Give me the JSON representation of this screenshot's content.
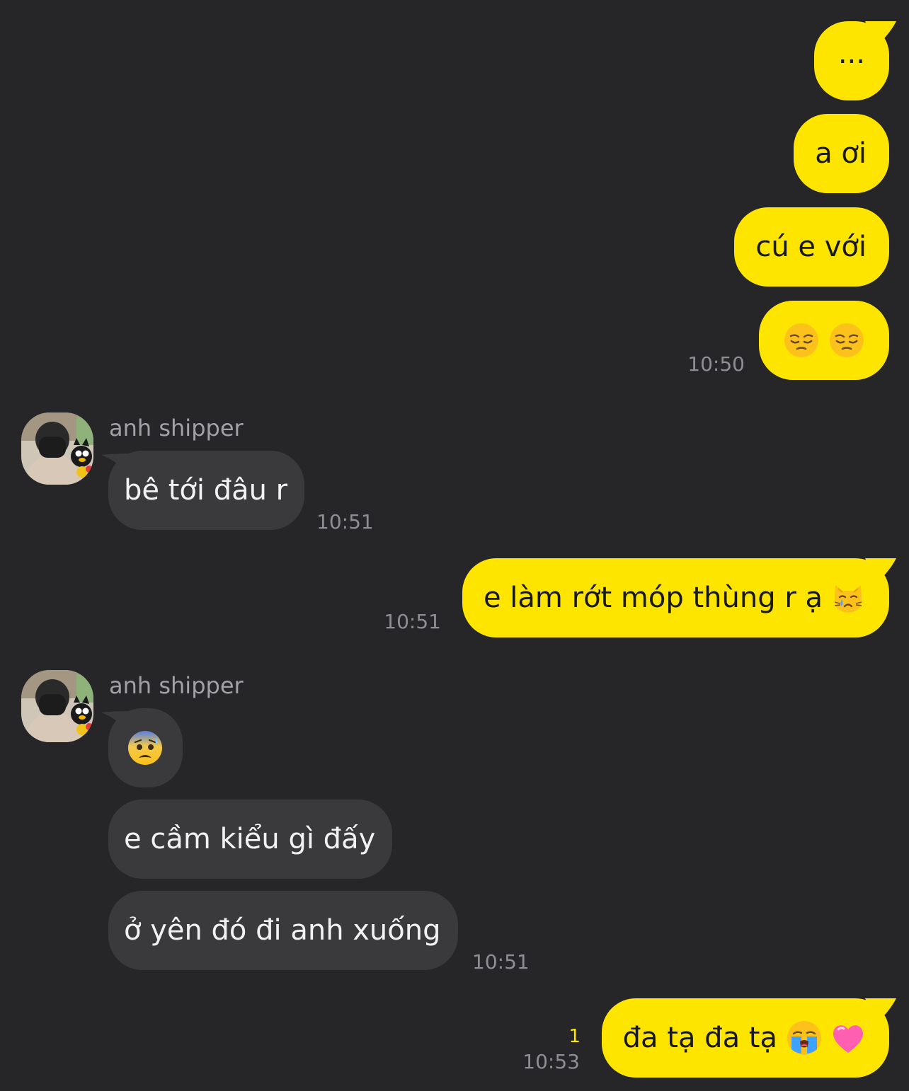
{
  "contact": {
    "name": "anh shipper"
  },
  "messages": [
    {
      "dir": "out",
      "text": "..."
    },
    {
      "dir": "out",
      "text": "a ơi"
    },
    {
      "dir": "out",
      "text": "cú e với"
    },
    {
      "dir": "out",
      "text": "",
      "emojis": [
        "pensive-face",
        "pensive-face"
      ],
      "time": "10:50"
    },
    {
      "dir": "in",
      "sender": "anh shipper",
      "text": "bê tới đâu r",
      "time": "10:51"
    },
    {
      "dir": "out",
      "text": "e làm rớt móp thùng r ạ",
      "emojis": [
        "crying-cat-face"
      ],
      "time": "10:51"
    },
    {
      "dir": "in",
      "sender": "anh shipper",
      "text": "",
      "emojis": [
        "anxious-face-with-sweat"
      ]
    },
    {
      "dir": "in",
      "text": "e cầm kiểu gì đấy"
    },
    {
      "dir": "in",
      "text": "ở yên đó đi anh xuống",
      "time": "10:51"
    },
    {
      "dir": "out",
      "text": "đa tạ đa tạ",
      "emojis": [
        "loudly-crying-face",
        "pink-heart"
      ],
      "time": "10:53",
      "unread": "1"
    }
  ],
  "colors": {
    "background": "#262628",
    "outgoing_bubble": "#fee500",
    "incoming_bubble": "#3a3a3c",
    "timestamp": "#8e8e93",
    "unread_count": "#fee500"
  }
}
